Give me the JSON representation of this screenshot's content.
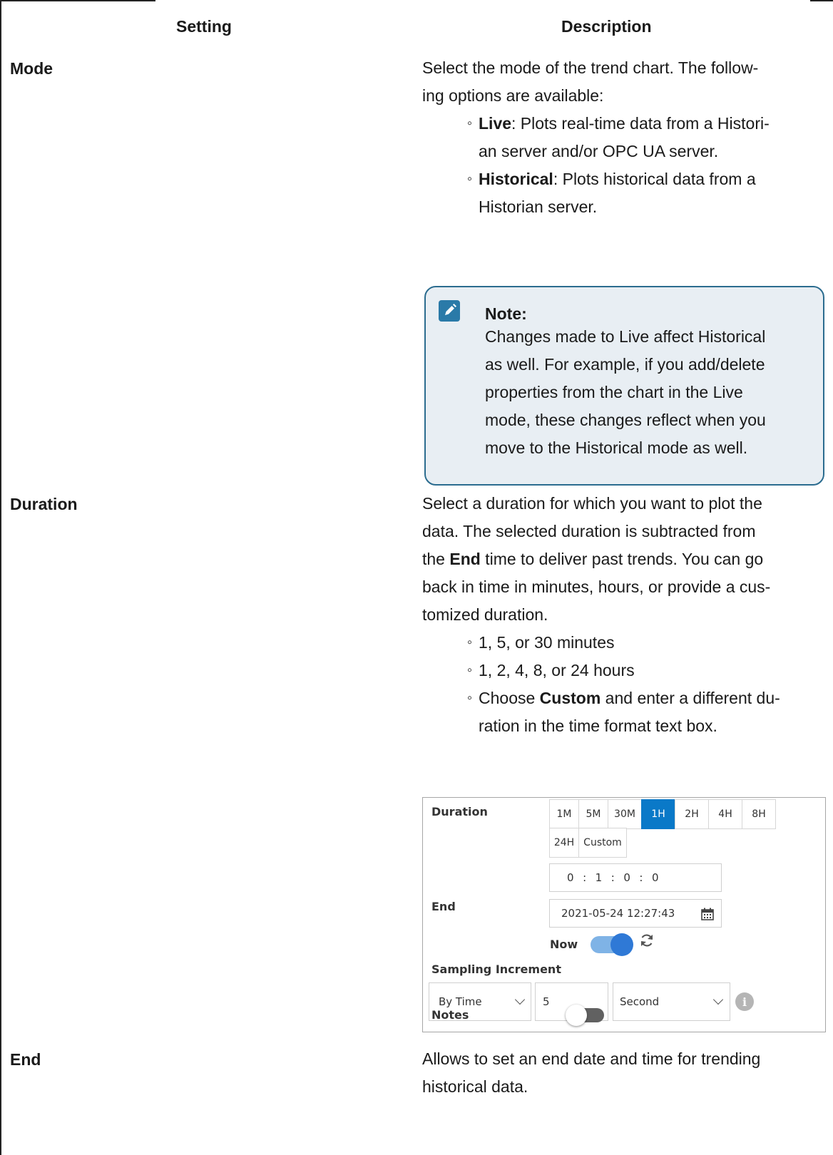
{
  "table": {
    "headers": {
      "setting": "Setting",
      "description": "Description"
    },
    "rows": {
      "mode": {
        "setting": "Mode",
        "intro_1": "Select the mode of the trend chart. The follow-",
        "intro_2": "ing options are available:",
        "live_term": "Live",
        "live_1": ": Plots real-time data from a Histori-",
        "live_2": "an server and/or OPC UA server.",
        "hist_term": "Historical",
        "hist_1": ": Plots historical data from a",
        "hist_2": "Historian server.",
        "note": {
          "title": "Note:",
          "lines": [
            "Changes made to Live affect Historical",
            "as well. For example, if you add/delete",
            "properties from the chart in the Live",
            "mode, these changes reflect when you",
            "move to the Historical mode as well."
          ]
        }
      },
      "duration": {
        "setting": "Duration",
        "l1": "Select a duration for which you want to plot the",
        "l2": "data. The selected duration is subtracted from",
        "l3_pre": "the ",
        "l3_term": "End",
        "l3_post": " time to deliver past trends. You can go",
        "l4": "back in time in minutes, hours, or provide a cus-",
        "l5": "tomized duration.",
        "b1": "1, 5, or 30 minutes",
        "b2": "1, 2, 4, 8, or 24 hours",
        "b3_pre": "Choose ",
        "b3_term": "Custom",
        "b3_post": " and enter a different du-",
        "b3_2": "ration in the time format text box."
      },
      "end": {
        "setting": "End",
        "l1": "Allows to set an end date and time for trending",
        "l2": "historical data."
      }
    }
  },
  "screenshot": {
    "duration_label": "Duration",
    "duration_options": [
      "1M",
      "5M",
      "30M",
      "1H",
      "2H",
      "4H",
      "8H",
      "24H",
      "Custom"
    ],
    "selected_option": "1H",
    "custom_time": "0  :  1  :  0  :  0",
    "end_label": "End",
    "end_value": "2021-05-24 12:27:43",
    "now_label": "Now",
    "now_on": true,
    "sampling_label": "Sampling Increment",
    "sampling_type": "By Time",
    "sampling_value": "5",
    "sampling_unit": "Second",
    "notes_label": "Notes",
    "notes_on": false,
    "accent_color": "#0a79c8"
  }
}
